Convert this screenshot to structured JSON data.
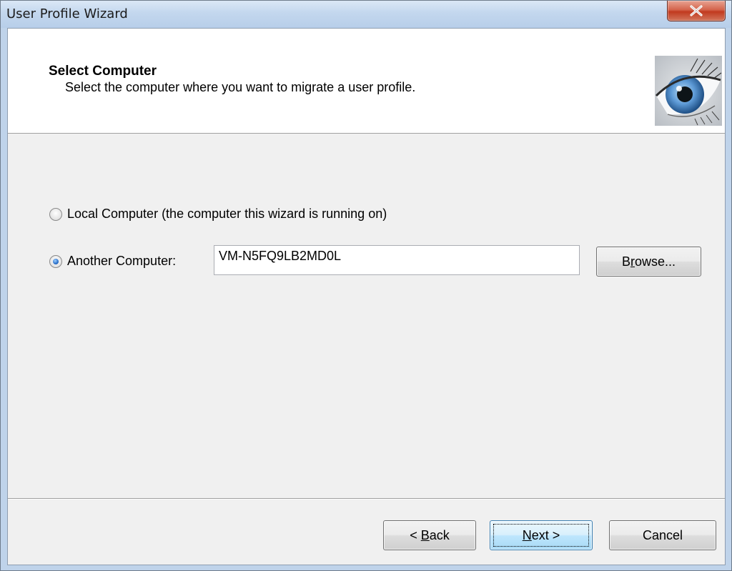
{
  "window": {
    "title": "User Profile Wizard"
  },
  "header": {
    "title": "Select Computer",
    "subtitle": "Select the computer where you want to migrate a user profile."
  },
  "options": {
    "local_label": "Local Computer (the computer this wizard is running on)",
    "local_checked": false,
    "another_label": "Another Computer:",
    "another_checked": true
  },
  "computer_field": {
    "value": "VM-N5FQ9LB2MD0L"
  },
  "buttons": {
    "browse_pre": "B",
    "browse_access": "r",
    "browse_post": "owse...",
    "back_pre": "< ",
    "back_access": "B",
    "back_post": "ack",
    "next_access": "N",
    "next_post": "ext >",
    "cancel": "Cancel"
  },
  "icons": {
    "close": "close-icon",
    "header_image": "eye-image"
  },
  "colors": {
    "close_button": "#c13a1f",
    "focus_button": "#3c7fb1",
    "radio_selected": "#2a6fc9"
  }
}
